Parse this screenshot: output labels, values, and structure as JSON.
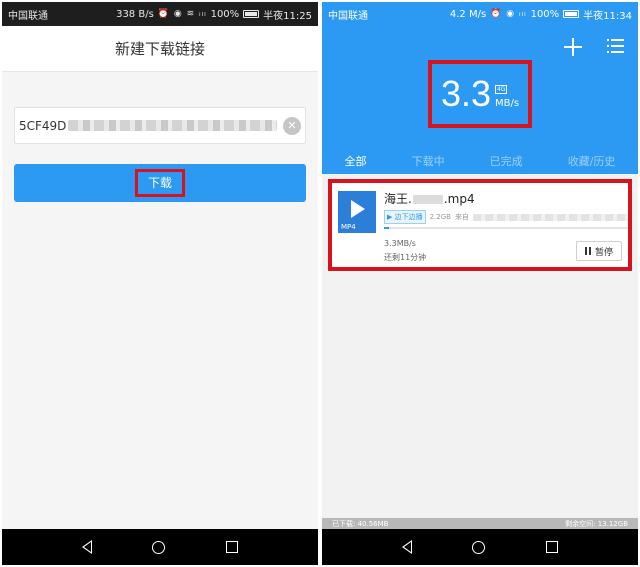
{
  "left_phone": {
    "status": {
      "carrier": "中国联通",
      "speed": "338 B/s",
      "battery": "100%",
      "time": "半夜11:25"
    },
    "header_title": "新建下载链接",
    "url_field": {
      "value": "5CF49D"
    },
    "download_label": "下载",
    "highlight_color": "#d6131f"
  },
  "right_phone": {
    "status": {
      "carrier": "中国联通",
      "speed": "4.2 M/s",
      "battery": "100%",
      "time": "半夜11:34"
    },
    "speed": {
      "value": "3.3",
      "unit": "MB/s",
      "badge": "4G"
    },
    "tabs": [
      "全部",
      "下载中",
      "已完成",
      "收藏/历史"
    ],
    "active_tab": 0,
    "task": {
      "name_prefix": "海王.",
      "name_suffix": ".mp4",
      "thumb_label": "MP4",
      "play_badge": "边下边播",
      "size": "2.2GB",
      "source_label": "来自",
      "progress": 0.02,
      "speed": "3.3MB/s",
      "remaining": "还剩11分钟",
      "pause_label": "暂停"
    },
    "storage": {
      "downloaded": "已下载: 40.56MB",
      "free": "剩余空间: 13.12GB"
    }
  },
  "brand_color": "#2c9af2"
}
